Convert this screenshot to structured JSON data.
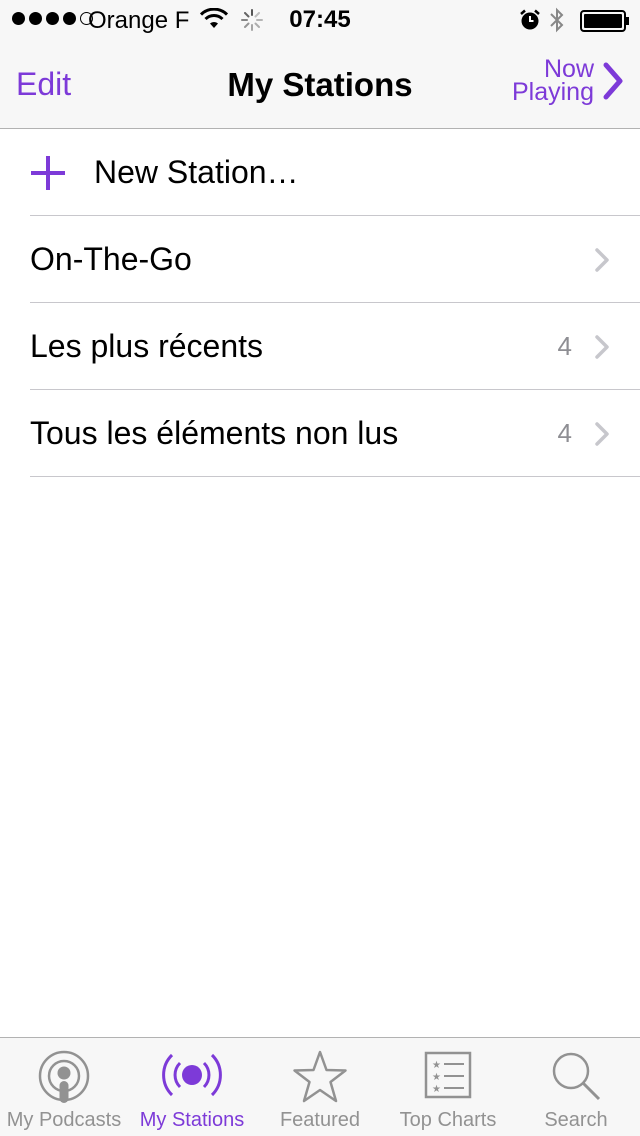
{
  "status_bar": {
    "carrier": "Orange F",
    "time": "07:45",
    "signal_bars_filled": 4,
    "signal_bars_total": 5
  },
  "nav": {
    "edit_label": "Edit",
    "title": "My Stations",
    "now_playing_line1": "Now",
    "now_playing_line2": "Playing"
  },
  "list": {
    "new_station_label": "New Station…",
    "items": [
      {
        "label": "On-The-Go",
        "count": ""
      },
      {
        "label": "Les plus récents",
        "count": "4"
      },
      {
        "label": "Tous les éléments non lus",
        "count": "4"
      }
    ]
  },
  "tabs": [
    {
      "label": "My Podcasts",
      "icon": "podcasts-icon",
      "active": false
    },
    {
      "label": "My Stations",
      "icon": "stations-icon",
      "active": true
    },
    {
      "label": "Featured",
      "icon": "star-icon",
      "active": false
    },
    {
      "label": "Top Charts",
      "icon": "charts-icon",
      "active": false
    },
    {
      "label": "Search",
      "icon": "search-icon",
      "active": false
    }
  ],
  "colors": {
    "accent": "#7d3ad8",
    "inactive": "#929292",
    "separator": "#c8c7cc",
    "chevron": "#c7c7cc"
  }
}
